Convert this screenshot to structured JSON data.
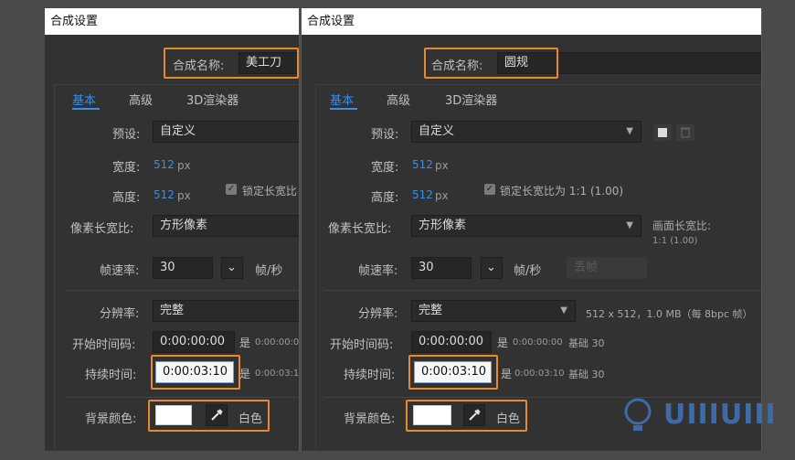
{
  "left": {
    "title": "合成设置",
    "comp_name_label": "合成名称:",
    "comp_name_value": "美工刀",
    "tabs": [
      "基本",
      "高级",
      "3D渲染器"
    ],
    "preset_label": "预设:",
    "preset_value": "自定义",
    "width_label": "宽度:",
    "width_value": "512",
    "height_label": "高度:",
    "height_value": "512",
    "unit_px": "px",
    "lock_label": "锁定长宽比",
    "par_label": "像素长宽比:",
    "par_value": "方形像素",
    "fps_label": "帧速率:",
    "fps_value": "30",
    "fps_unit": "帧/秒",
    "res_label": "分辨率:",
    "res_value": "完整",
    "start_label": "开始时间码:",
    "start_value": "0:00:00:00",
    "start_is": "是",
    "start_info": "0:00:00:0",
    "dur_label": "持续时间:",
    "dur_value": "0:00:03:10",
    "dur_is": "是",
    "dur_info": "0:00:03:1",
    "bg_label": "背景颜色:",
    "bg_color_name": "白色"
  },
  "right": {
    "title": "合成设置",
    "comp_name_label": "合成名称:",
    "comp_name_value": "圆规",
    "tabs": [
      "基本",
      "高级",
      "3D渲染器"
    ],
    "preset_label": "预设:",
    "preset_value": "自定义",
    "width_label": "宽度:",
    "width_value": "512",
    "height_label": "高度:",
    "height_value": "512",
    "unit_px": "px",
    "lock_label": "锁定长宽比为 1:1 (1.00)",
    "par_label": "像素长宽比:",
    "par_value": "方形像素",
    "frame_ar_label": "画面长宽比:",
    "frame_ar_value": "1:1 (1.00)",
    "fps_label": "帧速率:",
    "fps_value": "30",
    "fps_unit": "帧/秒",
    "drop_frame": "丢帧",
    "res_label": "分辨率:",
    "res_value": "完整",
    "res_info": "512 x 512，1.0 MB（每 8bpc 帧）",
    "start_label": "开始时间码:",
    "start_value": "0:00:00:00",
    "start_is": "是",
    "start_info": "0:00:00:00",
    "start_base": "基础 30",
    "dur_label": "持续时间:",
    "dur_value": "0:00:03:10",
    "dur_is": "是",
    "dur_info": "0:00:03:10",
    "dur_base": "基础 30",
    "bg_label": "背景颜色:",
    "bg_color_name": "白色"
  },
  "colors": {
    "accent": "#3a8ee6",
    "highlight": "#e78a2c",
    "panel_bg": "#323232"
  },
  "watermark": {
    "logo_text": "UIIIUIII"
  }
}
